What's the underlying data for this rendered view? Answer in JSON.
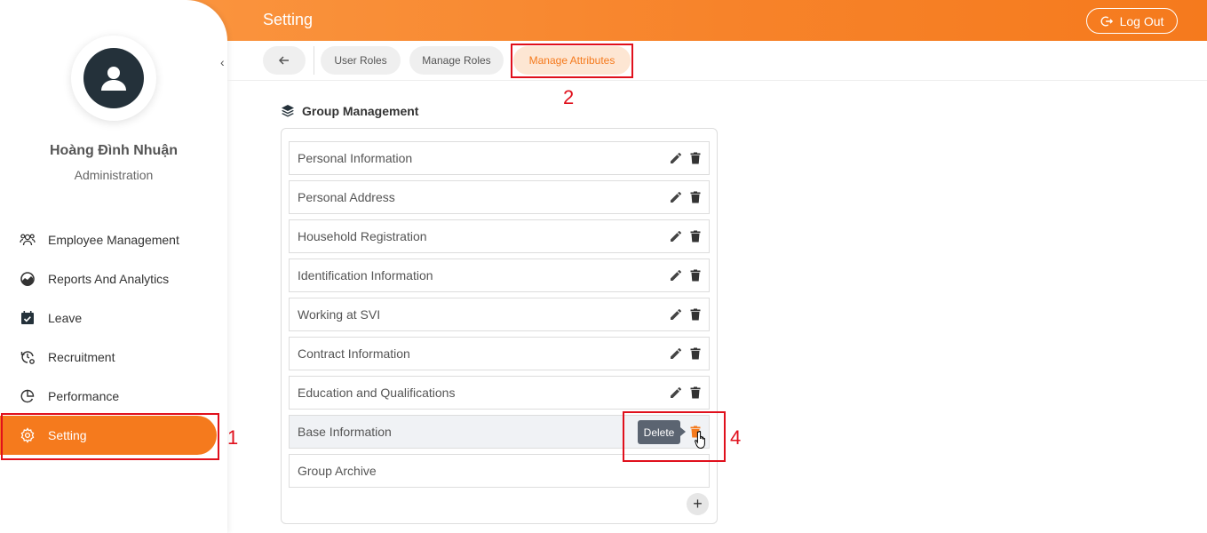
{
  "header": {
    "title": "Setting",
    "logout_label": "Log Out"
  },
  "profile": {
    "name": "Hoàng Đình Nhuận",
    "role": "Administration"
  },
  "sidebar": {
    "items": [
      {
        "label": "Employee Management",
        "icon": "users-icon"
      },
      {
        "label": "Reports And Analytics",
        "icon": "chart-icon"
      },
      {
        "label": "Leave",
        "icon": "calendar-check-icon"
      },
      {
        "label": "Recruitment",
        "icon": "recruitment-icon"
      },
      {
        "label": "Performance",
        "icon": "performance-icon"
      },
      {
        "label": "Setting",
        "icon": "gear-icon",
        "active": true
      }
    ]
  },
  "tabs": {
    "user_roles": "User Roles",
    "manage_roles": "Manage Roles",
    "manage_attributes": "Manage Attributes"
  },
  "annotations": [
    "1",
    "2",
    "4"
  ],
  "group_management": {
    "title": "Group Management",
    "groups": [
      "Personal Information",
      "Personal Address",
      "Household Registration",
      "Identification Information",
      "Working at SVI",
      "Contract Information",
      "Education and Qualifications",
      "Base Information",
      "Group Archive"
    ],
    "tooltip": "Delete"
  },
  "colors": {
    "accent": "#f57a1d",
    "annotation": "#e0101c"
  }
}
